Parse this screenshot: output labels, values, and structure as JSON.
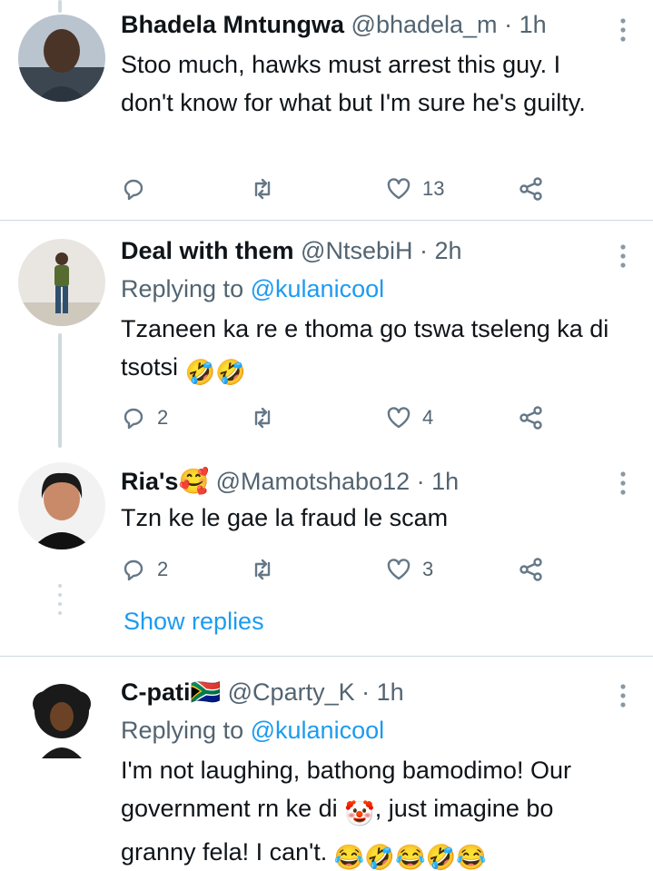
{
  "tweets": [
    {
      "name": "Bhadela Mntungwa",
      "handle": "@bhadela_m",
      "time": "1h",
      "text": "Stoo much, hawks must arrest this guy. I don't know for what but I'm sure he's guilty.",
      "replies": "",
      "likes": "13"
    },
    {
      "name": "Deal with them",
      "handle": "@NtsebiH",
      "time": "2h",
      "replying_prefix": "Replying to",
      "replying_to": "@kulanicool",
      "text": "Tzaneen ka re e thoma go tswa tseleng ka di tsotsi",
      "text_emoji": "🤣🤣",
      "replies": "2",
      "likes": "4"
    },
    {
      "name": "Ria's",
      "name_emoji": "🥰",
      "handle": "@Mamotshabo12",
      "time": "1h",
      "text": "Tzn ke le gae la fraud le scam",
      "replies": "2",
      "likes": "3"
    },
    {
      "name": "C-pati",
      "name_emoji": "🇿🇦",
      "handle": "@Cparty_K",
      "time": "1h",
      "replying_prefix": "Replying to",
      "replying_to": "@kulanicool",
      "text_1": "I'm not laughing, bathong bamodimo! Our government rn ke di",
      "clown_emoji": "🤡",
      "text_2": ", just imagine bo granny fela! I can't.",
      "text_emoji": "😂🤣😂🤣😂"
    }
  ],
  "show_replies": "Show replies",
  "separator": "·",
  "colors": {
    "accent": "#1d9bf0",
    "muted": "#536471",
    "line": "#cfd9de"
  },
  "icons": [
    "reply-icon",
    "retweet-icon",
    "like-icon",
    "share-icon",
    "more-icon"
  ]
}
